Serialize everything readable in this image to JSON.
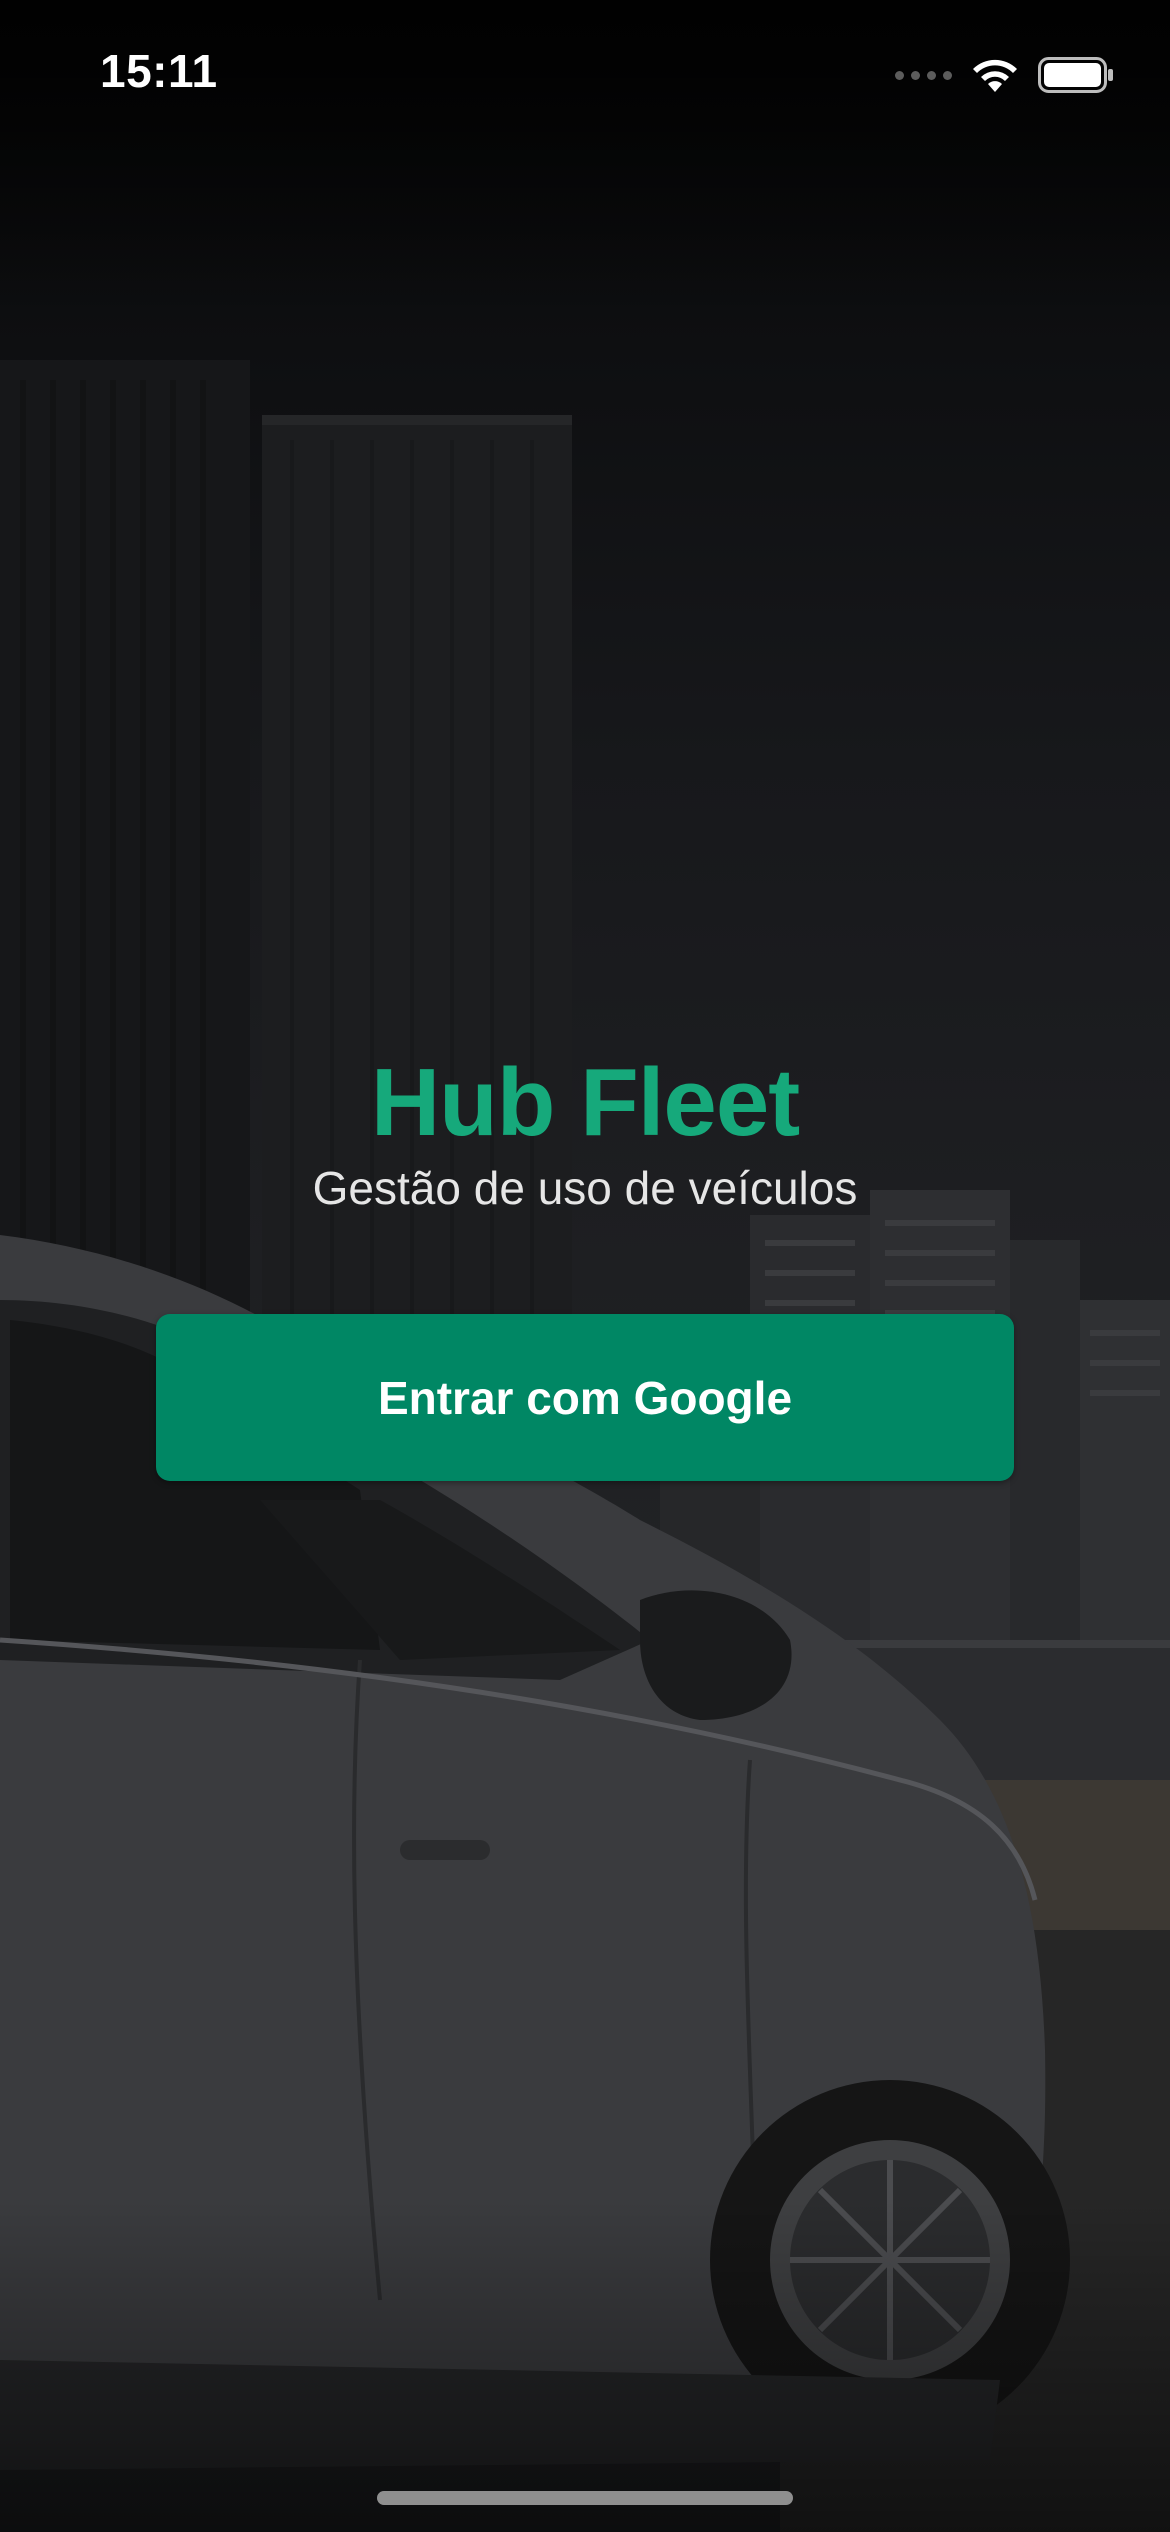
{
  "status_bar": {
    "time": "15:11"
  },
  "brand": {
    "title": "Hub Fleet",
    "subtitle": "Gestão de uso de veículos"
  },
  "login": {
    "google_button_label": "Entrar com Google"
  },
  "colors": {
    "accent": "#16a97b",
    "button": "#008764",
    "background": "#1e1f22"
  },
  "icons": {
    "signal": "cellular-signal-icon",
    "wifi": "wifi-icon",
    "battery": "battery-icon"
  }
}
